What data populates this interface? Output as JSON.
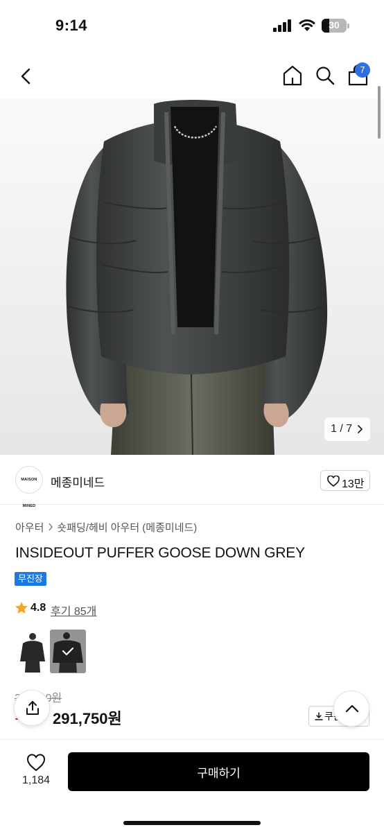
{
  "status_bar": {
    "time": "9:14",
    "battery": "30"
  },
  "nav": {
    "cart_count": "7"
  },
  "gallery": {
    "pager": "1 / 7"
  },
  "brand": {
    "logo_text": "MAISON MINED",
    "name": "메종미네드",
    "likes": "13만"
  },
  "product": {
    "breadcrumb": [
      "아우터",
      "숏패딩/헤비 아우터 (메종미네드)"
    ],
    "title": "INSIDEOUT PUFFER GOOSE DOWN GREY",
    "tag": "무진장",
    "rating": "4.8",
    "reviews": "후기 85개",
    "original_price": "35 ,000원",
    "discount": "1",
    "sale_price": "291,750원",
    "coupon_label": "쿠폰"
  },
  "bottom_bar": {
    "wish_count": "1,184",
    "buy_label": "구매하기"
  },
  "colors": {
    "accent": "#2f6fe4",
    "tag": "#1f7ae0",
    "discount": "#e02020",
    "star": "#f5a623",
    "buy": "#000000"
  }
}
